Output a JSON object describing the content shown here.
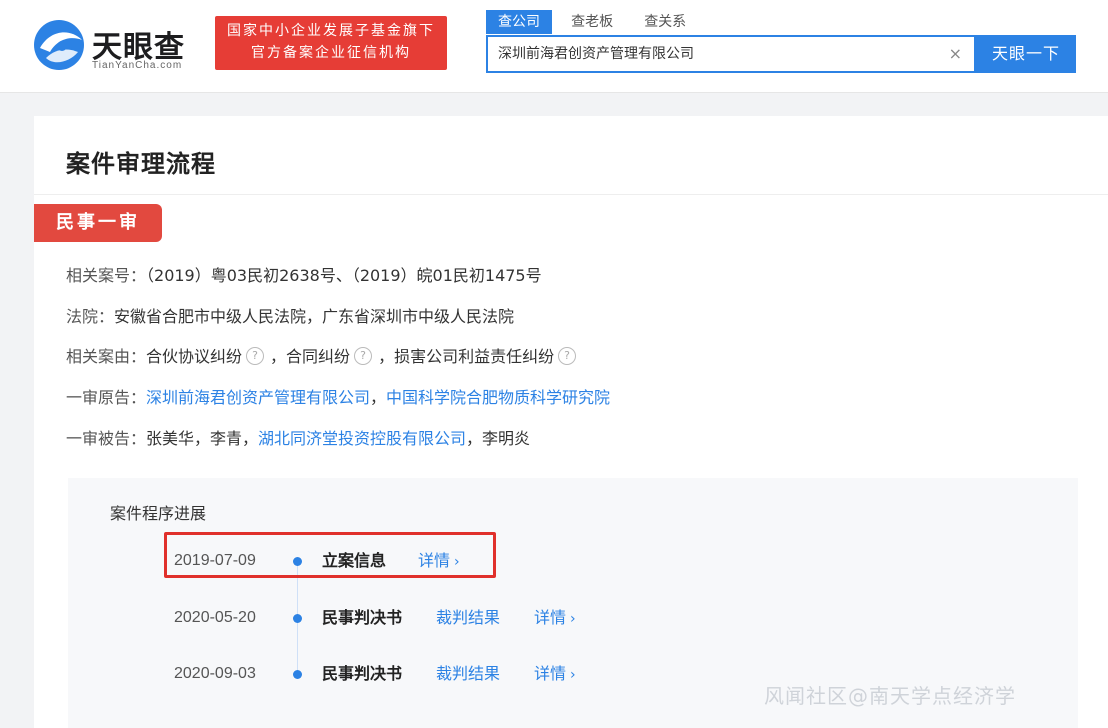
{
  "header": {
    "logo_cn": "天眼查",
    "logo_en": "TianYanCha.com",
    "banner_line1": "国家中小企业发展子基金旗下",
    "banner_line2": "官方备案企业征信机构",
    "tabs": [
      "查公司",
      "查老板",
      "查关系"
    ],
    "search_value": "深圳前海君创资产管理有限公司",
    "clear_glyph": "×",
    "search_button": "天眼一下"
  },
  "card": {
    "title": "案件审理流程",
    "stage_tag": "民事一审",
    "case_numbers_label": "相关案号：",
    "case_numbers_value": "（2019）粤03民初2638号、（2019）皖01民初1475号",
    "court_label": "法院：",
    "court_value": "安徽省合肥市中级人民法院，广东省深圳市中级人民法院",
    "cause_label": "相关案由：",
    "causes": [
      "合伙协议纠纷",
      "合同纠纷",
      "损害公司利益责任纠纷"
    ],
    "cause_separator": "，",
    "help_glyph": "?",
    "plaintiff_label": "一审原告：",
    "plaintiffs": [
      "深圳前海君创资产管理有限公司",
      "中国科学院合肥物质科学研究院"
    ],
    "defendant_label": "一审被告：",
    "defendant_plain1": "张美华，李青，",
    "defendant_link": "湖北同济堂投资控股有限公司",
    "defendant_plain2": "，李明炎"
  },
  "progress": {
    "title": "案件程序进展",
    "items": [
      {
        "date": "2019-07-09",
        "name": "立案信息",
        "detail": "详情"
      },
      {
        "date": "2020-05-20",
        "name": "民事判决书",
        "result": "裁判结果",
        "detail": "详情"
      },
      {
        "date": "2020-09-03",
        "name": "民事判决书",
        "result": "裁判结果",
        "detail": "详情"
      }
    ],
    "chevron": "›"
  },
  "watermark": "风闻社区@南天学点经济学",
  "colors": {
    "accent": "#2c82e4",
    "red": "#e2493f",
    "highlight": "#e0302b"
  }
}
